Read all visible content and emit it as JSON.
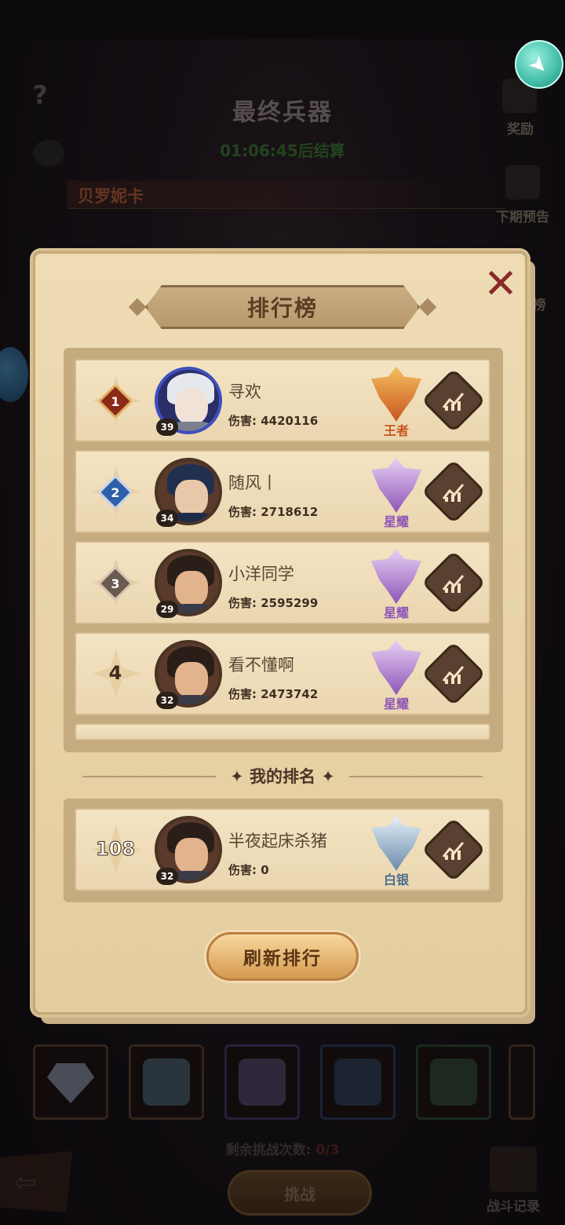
{
  "background": {
    "title": "最终兵器",
    "timer": "01:06:45后结算",
    "boss_name": "贝罗妮卡",
    "side_buttons": [
      {
        "label": "奖励",
        "icon": "treasure-chest-icon"
      },
      {
        "label": "下期预告",
        "icon": "scroll-icon"
      },
      {
        "label": "榜",
        "icon": "ranking-icon"
      }
    ],
    "remaining_label": "剩余挑战次数:",
    "remaining_count": "0/3",
    "challenge_label": "挑战",
    "battle_log_label": "战斗记录",
    "help_icon": "question-icon",
    "rocket_icon": "rocket-icon",
    "back_icon": "back-arrow-icon",
    "weapons": [
      {
        "icon": "diamond-icon",
        "color": "#a9b6cf"
      },
      {
        "icon": "axe-icon",
        "color": "#5d7a8c"
      },
      {
        "icon": "axe-icon",
        "color": "#6b5a87"
      },
      {
        "icon": "axe-icon",
        "color": "#3c5070"
      },
      {
        "icon": "axe-icon",
        "color": "#3c5c48"
      },
      {
        "icon": "axe-icon",
        "color": "#5a4a40"
      }
    ]
  },
  "modal": {
    "title": "排行榜",
    "close_icon": "close-x-icon",
    "damage_label": "伤害:",
    "rankings": [
      {
        "rank": "1",
        "name": "寻欢",
        "damage": "4420116",
        "level": "39",
        "tier": "王者",
        "tier_color": "#c9551e",
        "badge_color": "#8c2a18",
        "avatar": "elf-icon"
      },
      {
        "rank": "2",
        "name": "随风丨",
        "damage": "2718612",
        "level": "34",
        "tier": "星耀",
        "tier_color": "#8e55b8",
        "badge_color": "#2f5fa8",
        "avatar": "pirate-captain-icon"
      },
      {
        "rank": "3",
        "name": "小洋同学",
        "damage": "2595299",
        "level": "29",
        "tier": "星耀",
        "tier_color": "#8e55b8",
        "badge_color": "#6a5a50",
        "avatar": "mustache-man-icon"
      },
      {
        "rank": "4",
        "name": "看不懂啊",
        "damage": "2473742",
        "level": "32",
        "tier": "星耀",
        "tier_color": "#8e55b8",
        "badge_color": "",
        "avatar": "mustache-man-icon"
      }
    ],
    "my_rank_label": "我的排名",
    "my_rank": {
      "rank": "108",
      "name": "半夜起床杀猪",
      "damage": "0",
      "level": "32",
      "tier": "白银",
      "tier_color": "#4a6e90",
      "avatar": "mustache-man-icon"
    },
    "refresh_label": "刷新排行",
    "trend_icon": "trend-chart-icon"
  }
}
